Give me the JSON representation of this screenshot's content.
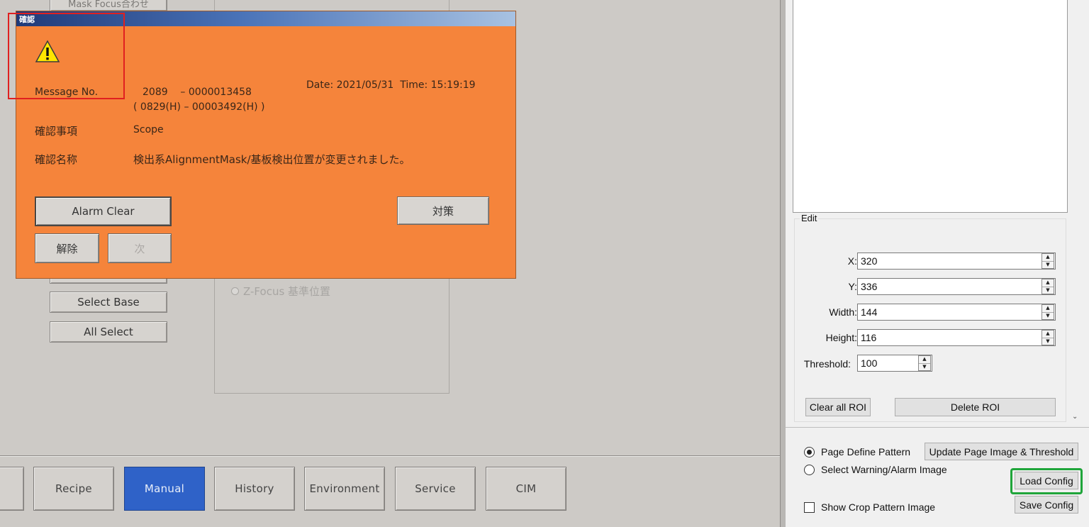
{
  "background_app": {
    "top_partial_button_label": "Mask Focus合わせ",
    "select_base_label": "Select Base",
    "all_select_label": "All Select",
    "z_focus_radio_label": "Z-Focus 基準位置",
    "tabs": [
      {
        "label": ""
      },
      {
        "label": "Recipe"
      },
      {
        "label": "Manual",
        "active": true
      },
      {
        "label": "History"
      },
      {
        "label": "Environment"
      },
      {
        "label": "Service"
      },
      {
        "label": "CIM"
      }
    ],
    "active_tab_color": "#2f62c8"
  },
  "dialog": {
    "title": "確認",
    "background_color": "#f5843b",
    "icon": "warning-triangle-icon",
    "message_no_label": "Message No.",
    "message_no_value": "2089    – 0000013458",
    "message_no_hex": "( 0829(H) – 00003492(H) )",
    "date_time": "Date: 2021/05/31  Time: 15:19:19",
    "item_label": "確認事項",
    "item_value": "Scope",
    "name_label": "確認名称",
    "name_value": "検出系AlignmentMask/基板検出位置が変更されました。",
    "alarm_clear_label": "Alarm Clear",
    "countermeasure_label": "対策",
    "release_label": "解除",
    "next_label": "次"
  },
  "right_panel": {
    "edit_group_label": "Edit",
    "fields": [
      {
        "label": "X:",
        "value": "320"
      },
      {
        "label": "Y:",
        "value": "336"
      },
      {
        "label": "Width:",
        "value": "144"
      },
      {
        "label": "Height:",
        "value": "116"
      }
    ],
    "threshold_label": "Threshold:",
    "threshold_value": "100",
    "clear_all_roi_label": "Clear all ROI",
    "delete_roi_label": "Delete ROI",
    "radio_page_define_label": "Page Define Pattern",
    "radio_select_warning_label": "Select Warning/Alarm Image",
    "selected_radio": "Page Define Pattern",
    "update_page_image_label": "Update Page Image & Threshold",
    "load_config_label": "Load Config",
    "save_config_label": "Save Config",
    "show_crop_label": "Show Crop Pattern Image",
    "show_crop_checked": false
  },
  "highlights": {
    "red_box_color": "#e02020",
    "green_box_color": "#1fa53a"
  }
}
